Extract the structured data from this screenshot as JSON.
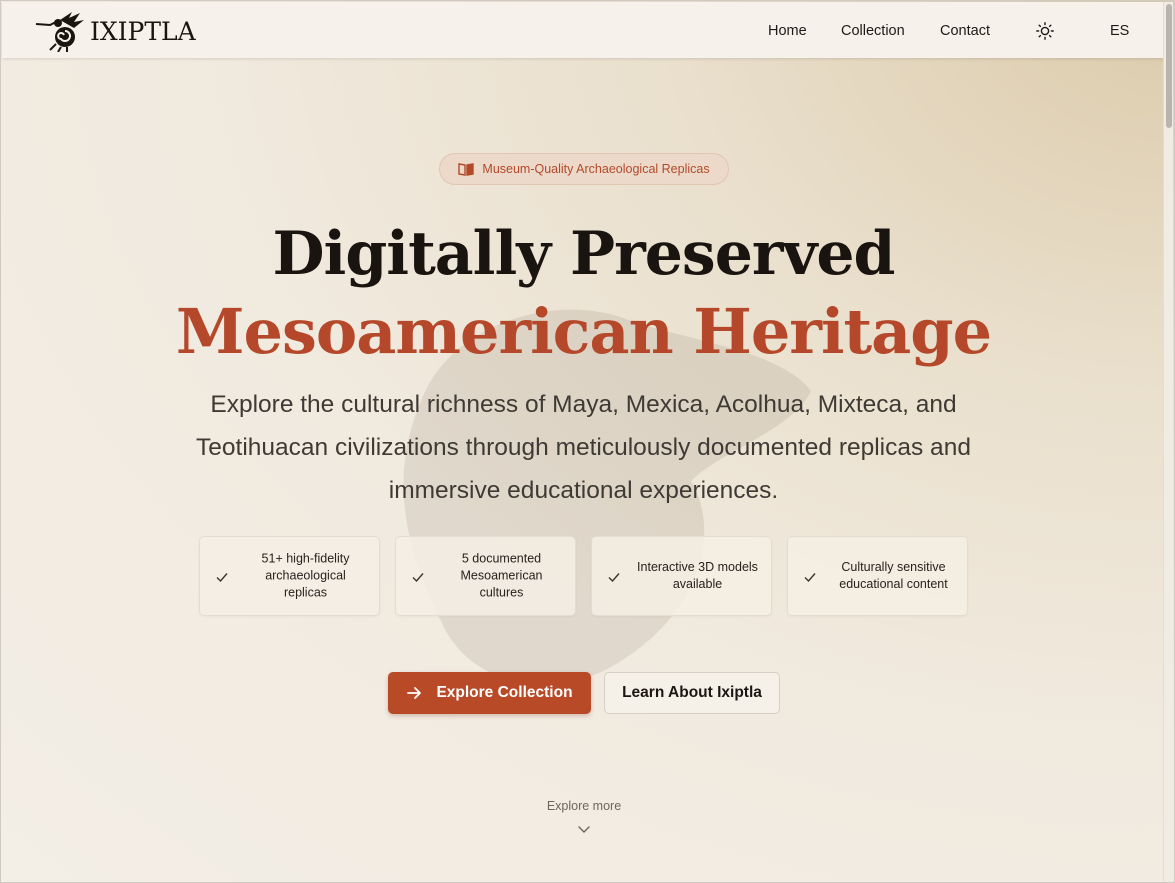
{
  "header": {
    "brand": "IXIPTLA",
    "nav": [
      {
        "label": "Home"
      },
      {
        "label": "Collection"
      },
      {
        "label": "Contact"
      }
    ],
    "theme_icon": "sun-icon",
    "language": "ES"
  },
  "hero": {
    "badge": "Museum-Quality Archaeological Replicas",
    "badge_icon": "book-open-icon",
    "title_line1": "Digitally Preserved",
    "title_line2": "Mesoamerican Heritage",
    "subtitle": "Explore the cultural richness of Maya, Mexica, Acolhua, Mixteca, and Teotihuacan civilizations through meticulously documented replicas and immersive educational experiences.",
    "features": [
      {
        "text": "51+ high-fidelity archaeological replicas"
      },
      {
        "text": "5 documented Mesoamerican cultures"
      },
      {
        "text": "Interactive 3D models available"
      },
      {
        "text": "Culturally sensitive educational content"
      }
    ],
    "primary_button": "Explore Collection",
    "secondary_button": "Learn About Ixiptla",
    "explore_more": "Explore more"
  },
  "colors": {
    "accent": "#b5482a",
    "background": "#f3eee6",
    "text": "#1a1410"
  }
}
